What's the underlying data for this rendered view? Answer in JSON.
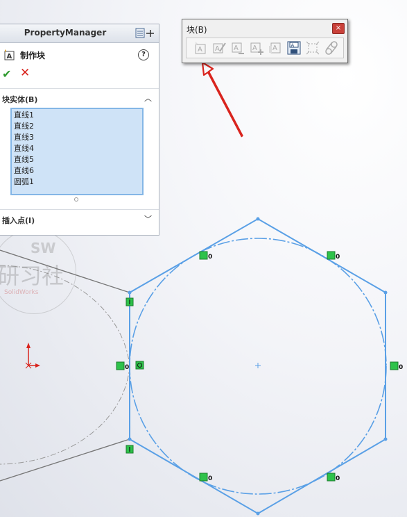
{
  "property_manager": {
    "title": "PropertyManager",
    "feature_label": "制作块",
    "help": "?",
    "ok": "✔",
    "cancel": "✕",
    "sections": {
      "block_entities": {
        "title": "块实体(B)",
        "chevron": "︿"
      },
      "insert_point": {
        "title": "插入点(I)",
        "chevron": "﹀"
      }
    },
    "entities": [
      "直线1",
      "直线2",
      "直线3",
      "直线4",
      "直线5",
      "直线6",
      "圆弧1"
    ]
  },
  "toolbar": {
    "title": "块(B)",
    "close": "×",
    "buttons": [
      "make-block-icon",
      "edit-block-icon",
      "insert-block-icon",
      "add-remove-icon",
      "rebuild-block-icon",
      "save-block-icon",
      "explode-block-icon",
      "belt-chain-icon"
    ]
  },
  "watermark": {
    "sw": "SW",
    "cn": "研习社",
    "sub": "SolidWorks"
  },
  "relation_labels": {
    "coincident_label": "0"
  },
  "colors": {
    "sketch_blue": "#5aa0e6",
    "relation_green": "#2ec24a",
    "arrow_red": "#d9241e"
  }
}
